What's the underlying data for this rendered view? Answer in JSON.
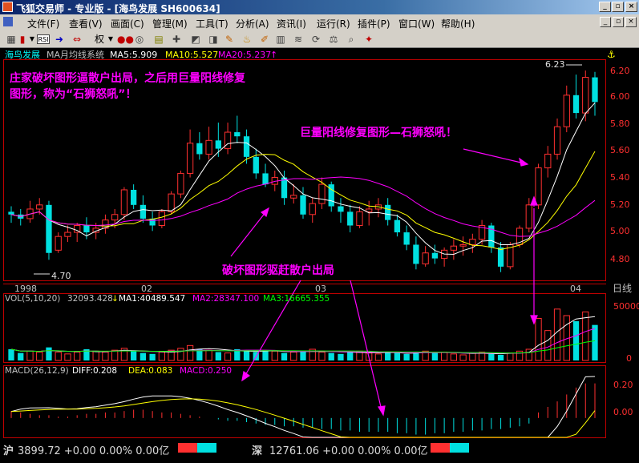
{
  "window": {
    "title": "飞狐交易师 - 专业版 - [海鸟发展 SH600634]",
    "minimize_glyph": "_",
    "restore_glyph": "▫",
    "close_glyph": "×"
  },
  "menu": {
    "items": [
      "文件(F)",
      "查看(V)",
      "画面(C)",
      "管理(M)",
      "工具(T)",
      "分析(A)",
      "资讯(I)",
      "运行(R)",
      "插件(P)",
      "窗口(W)",
      "帮助(H)"
    ]
  },
  "toolbar": {
    "icons": [
      "grid-icon",
      "bar-chart-icon",
      "dropdown-arrow-icon",
      "rsi-icon",
      "arrow-icon",
      "exchange-icon",
      "weight-icon",
      "glasses-icon",
      "circle-icon",
      "calculator-icon",
      "cross-icon",
      "cursor-icon",
      "shapes-icon",
      "text-icon",
      "pen-icon",
      "bell-icon",
      "wave-icon",
      "grid-table-icon",
      "rotate-icon",
      "scale-icon",
      "search-icon",
      "brush-icon",
      "star-icon"
    ],
    "weight_label": "权"
  },
  "chart": {
    "stock_name": "海鸟发展",
    "indicator_name": "MA月均线系统",
    "ma5": "MA5:5.909",
    "ma10": "MA10:5.527",
    "ma20": "MA20:5.237",
    "up_arrow": "↑",
    "high_label": "6.23",
    "low_label": "4.70",
    "y_ticks": [
      "6.20",
      "6.00",
      "5.80",
      "5.60",
      "5.40",
      "5.20",
      "5.00",
      "4.80"
    ],
    "x_ticks": [
      "1998",
      "02",
      "03",
      "04"
    ],
    "period_label": "日线",
    "annotation_main": "庄家破坏图形逼散户出局，之后用巨量阳线修复图形，称为“石狮怒吼”！",
    "annotation_main_line1": "庄家破坏图形逼散户出局，之后用巨量阳线修复",
    "annotation_main_line2": "图形，称为“石狮怒吼”！",
    "annotation_right": "巨量阳线修复图形—石狮怒吼！",
    "annotation_bottom": "破坏图形驱赶散户出局"
  },
  "volume": {
    "label": "VOL(5,10,20)",
    "value": "32093.428",
    "down_arrow": "↓",
    "ma1": "MA1:40489.547",
    "ma2": "MA2:28347.100",
    "ma3": "MA3:16665.355",
    "y_ticks": [
      "50000",
      "0"
    ]
  },
  "macd": {
    "label": "MACD(26,12,9)",
    "diff": "DIFF:0.208",
    "dea": "DEA:0.083",
    "macd": "MACD:0.250",
    "y_ticks": [
      "0.20",
      "0.00"
    ]
  },
  "status": {
    "sh_name": "沪",
    "sh_value": "3899.72 +0.00 0.00% 0.00亿",
    "sz_name": "深",
    "sz_value": "12761.06 +0.00 0.00% 0.00亿"
  },
  "colors": {
    "up_candle": "#ff3030",
    "down_candle": "#00e0e0",
    "ma5": "#ffffff",
    "ma10": "#ffff00",
    "ma20": "#ff00ff",
    "annotation": "#ff00ff",
    "axis": "#c00000"
  },
  "chart_data": [
    {
      "type": "candlestick",
      "title": "海鸟发展 MA月均线系统",
      "series": [
        {
          "name": "K",
          "ohlc": [
            [
              5.2,
              5.24,
              5.12,
              5.18
            ],
            [
              5.18,
              5.22,
              5.1,
              5.15
            ],
            [
              5.15,
              5.28,
              5.12,
              5.22
            ],
            [
              5.22,
              5.3,
              5.18,
              5.25
            ],
            [
              5.25,
              5.28,
              4.85,
              4.9
            ],
            [
              4.92,
              5.05,
              4.9,
              5.02
            ],
            [
              5.02,
              5.1,
              4.98,
              5.05
            ],
            [
              5.05,
              5.12,
              4.98,
              5.1
            ],
            [
              5.1,
              5.16,
              5.0,
              5.05
            ],
            [
              5.05,
              5.12,
              5.0,
              5.08
            ],
            [
              5.08,
              5.18,
              5.04,
              5.14
            ],
            [
              5.14,
              5.22,
              5.08,
              5.18
            ],
            [
              5.18,
              5.38,
              5.14,
              5.36
            ],
            [
              5.36,
              5.4,
              5.22,
              5.25
            ],
            [
              5.25,
              5.32,
              5.12,
              5.15
            ],
            [
              5.15,
              5.2,
              5.06,
              5.1
            ],
            [
              5.1,
              5.22,
              5.08,
              5.2
            ],
            [
              5.2,
              5.35,
              5.18,
              5.33
            ],
            [
              5.33,
              5.5,
              5.3,
              5.48
            ],
            [
              5.48,
              5.8,
              5.45,
              5.7
            ],
            [
              5.7,
              5.78,
              5.58,
              5.62
            ],
            [
              5.62,
              5.82,
              5.58,
              5.72
            ],
            [
              5.72,
              5.85,
              5.6,
              5.66
            ],
            [
              5.66,
              5.85,
              5.62,
              5.78
            ],
            [
              5.78,
              5.9,
              5.7,
              5.75
            ],
            [
              5.75,
              5.8,
              5.55,
              5.6
            ],
            [
              5.6,
              5.66,
              5.44,
              5.48
            ],
            [
              5.48,
              5.55,
              5.38,
              5.4
            ],
            [
              5.4,
              5.5,
              5.35,
              5.45
            ],
            [
              5.45,
              5.5,
              5.25,
              5.3
            ],
            [
              5.3,
              5.4,
              5.26,
              5.32
            ],
            [
              5.32,
              5.38,
              5.15,
              5.18
            ],
            [
              5.18,
              5.3,
              5.12,
              5.26
            ],
            [
              5.26,
              5.45,
              5.22,
              5.4
            ],
            [
              5.4,
              5.42,
              5.2,
              5.24
            ],
            [
              5.24,
              5.3,
              5.12,
              5.2
            ],
            [
              5.2,
              5.25,
              5.05,
              5.1
            ],
            [
              5.1,
              5.24,
              5.08,
              5.2
            ],
            [
              5.2,
              5.28,
              5.1,
              5.22
            ],
            [
              5.22,
              5.3,
              5.16,
              5.25
            ],
            [
              5.25,
              5.3,
              5.1,
              5.14
            ],
            [
              5.14,
              5.18,
              5.02,
              5.05
            ],
            [
              5.05,
              5.1,
              4.92,
              4.96
            ],
            [
              4.96,
              5.02,
              4.78,
              4.82
            ],
            [
              4.82,
              4.95,
              4.8,
              4.9
            ],
            [
              4.9,
              4.96,
              4.82,
              4.86
            ],
            [
              4.86,
              4.94,
              4.8,
              4.92
            ],
            [
              4.92,
              5.0,
              4.85,
              4.95
            ],
            [
              4.95,
              5.02,
              4.88,
              4.96
            ],
            [
              4.96,
              5.04,
              4.9,
              5.0
            ],
            [
              5.0,
              5.14,
              4.96,
              5.1
            ],
            [
              5.1,
              5.12,
              4.9,
              4.94
            ],
            [
              4.94,
              4.98,
              4.76,
              4.8
            ],
            [
              4.8,
              4.98,
              4.78,
              4.96
            ],
            [
              4.96,
              5.1,
              4.94,
              5.08
            ],
            [
              5.08,
              5.3,
              5.05,
              5.25
            ],
            [
              5.25,
              5.55,
              5.22,
              5.52
            ],
            [
              5.52,
              5.68,
              5.45,
              5.62
            ],
            [
              5.62,
              5.88,
              5.58,
              5.82
            ],
            [
              5.82,
              6.12,
              5.78,
              6.05
            ],
            [
              6.05,
              6.2,
              5.88,
              5.92
            ],
            [
              5.92,
              6.23,
              5.86,
              6.18
            ],
            [
              6.18,
              6.22,
              5.9,
              6.0
            ]
          ]
        },
        {
          "name": "MA5"
        },
        {
          "name": "MA10"
        },
        {
          "name": "MA20"
        }
      ],
      "ylim": [
        4.7,
        6.3
      ],
      "x_ticks": [
        "1998",
        "02",
        "03",
        "04"
      ],
      "y_ticks": [
        6.2,
        6.0,
        5.8,
        5.6,
        5.4,
        5.2,
        5.0,
        4.8
      ],
      "high": 6.23,
      "low": 4.7
    },
    {
      "type": "bar",
      "title": "VOL(5,10,20)",
      "values": [
        12000,
        8000,
        10000,
        9000,
        14000,
        9000,
        7000,
        9000,
        12000,
        10000,
        9000,
        11000,
        13000,
        10000,
        8000,
        7000,
        9000,
        11000,
        13000,
        16000,
        12000,
        11000,
        9000,
        8000,
        12000,
        10000,
        9000,
        11000,
        10000,
        8000,
        9000,
        10000,
        12000,
        9000,
        8000,
        7000,
        9000,
        10000,
        8000,
        7000,
        9000,
        8000,
        7000,
        9000,
        10000,
        8000,
        9000,
        7000,
        6000,
        8000,
        9000,
        7000,
        6000,
        8000,
        10000,
        12000,
        45000,
        32000,
        55000,
        48000,
        42000,
        52000,
        38000
      ],
      "ylim": [
        0,
        60000
      ],
      "y_ticks": [
        50000,
        0
      ]
    },
    {
      "type": "bar",
      "title": "MACD(26,12,9)",
      "values": [
        0.05,
        0.04,
        0.03,
        0.02,
        0.02,
        0.01,
        0.01,
        0.02,
        0.03,
        0.03,
        0.04,
        0.04,
        0.05,
        0.06,
        0.06,
        0.05,
        0.04,
        0.04,
        0.03,
        0.02,
        0.01,
        0.0,
        -0.01,
        -0.02,
        -0.02,
        -0.03,
        -0.04,
        -0.05,
        -0.05,
        -0.06,
        -0.06,
        -0.07,
        -0.07,
        -0.08,
        -0.08,
        -0.09,
        -0.09,
        -0.1,
        -0.1,
        -0.1,
        -0.1,
        -0.11,
        -0.11,
        -0.12,
        -0.12,
        -0.11,
        -0.11,
        -0.1,
        -0.1,
        -0.09,
        -0.09,
        -0.08,
        -0.08,
        -0.07,
        -0.06,
        -0.04,
        0.04,
        0.08,
        0.12,
        0.17,
        0.22,
        0.25,
        0.25
      ],
      "ylim": [
        -0.14,
        0.3
      ],
      "y_ticks": [
        0.2,
        0.0
      ]
    }
  ]
}
